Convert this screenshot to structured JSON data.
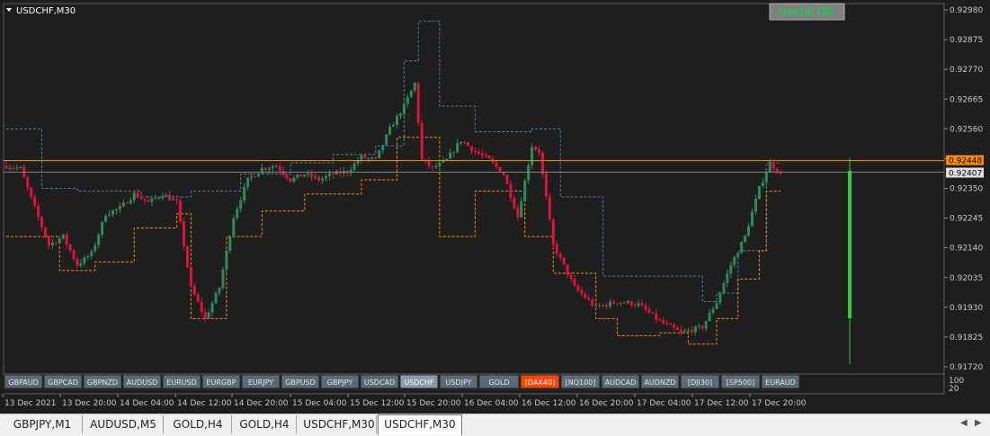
{
  "window": {
    "title": "USDCHF,M30"
  },
  "indicator_button": {
    "label": "fractal ON",
    "color": "#00e040"
  },
  "colors": {
    "background": "#1e1e1e",
    "bull_candle": "#2e8b57",
    "bear_candle": "#dc143c",
    "upper_fractal_line": "#4d7ea8",
    "lower_fractal_line": "#ff8c00",
    "bid_line": "#ff8c00",
    "ask_line": "#808080",
    "histogram": "#32cd32",
    "grid_text": "#c8c8c8"
  },
  "price_axis": {
    "ticks": [
      "0.92980",
      "0.92875",
      "0.92770",
      "0.92665",
      "0.92560",
      "0.92455",
      "0.92350",
      "0.92245",
      "0.92140",
      "0.92035",
      "0.91930",
      "0.91825",
      "0.91720"
    ],
    "current_bid_label": "0.92448",
    "current_ask_label": "0.92407",
    "sub_window_top": "100",
    "sub_window_bottom": "20"
  },
  "time_axis": {
    "labels": [
      "13 Dec 2021",
      "13 Dec 20:00",
      "14 Dec 04:00",
      "14 Dec 12:00",
      "14 Dec 20:00",
      "15 Dec 04:00",
      "15 Dec 12:00",
      "15 Dec 20:00",
      "16 Dec 04:00",
      "16 Dec 12:00",
      "16 Dec 20:00",
      "17 Dec 04:00",
      "17 Dec 12:00",
      "17 Dec 20:00"
    ]
  },
  "symbol_buttons": [
    {
      "label": "GBPAUD",
      "state": "normal"
    },
    {
      "label": "GBPCAD",
      "state": "normal"
    },
    {
      "label": "GBPNZD",
      "state": "normal"
    },
    {
      "label": "AUDUSD",
      "state": "normal"
    },
    {
      "label": "EURUSD",
      "state": "normal"
    },
    {
      "label": "EURGBP",
      "state": "normal"
    },
    {
      "label": "EURJPY",
      "state": "normal"
    },
    {
      "label": "GBPUSD",
      "state": "normal"
    },
    {
      "label": "GBPJPY",
      "state": "normal"
    },
    {
      "label": "USDCAD",
      "state": "normal"
    },
    {
      "label": "USDCHF",
      "state": "selected"
    },
    {
      "label": "USDJPY",
      "state": "normal"
    },
    {
      "label": "GOLD",
      "state": "normal"
    },
    {
      "label": "[DAX40]",
      "state": "highlight"
    },
    {
      "label": "[NQ100]",
      "state": "normal"
    },
    {
      "label": "AUDCAD",
      "state": "normal"
    },
    {
      "label": "AUDNZD",
      "state": "normal"
    },
    {
      "label": "[DJI30]",
      "state": "normal"
    },
    {
      "label": "[SP500]",
      "state": "normal"
    },
    {
      "label": "EURAUD",
      "state": "normal"
    }
  ],
  "tabs": [
    {
      "label": "GBPJPY,M1",
      "active": false
    },
    {
      "label": "AUDUSD,M5",
      "active": false
    },
    {
      "label": "GOLD,H4",
      "active": false
    },
    {
      "label": "GOLD,H4",
      "active": false
    },
    {
      "label": "USDCHF,M30",
      "active": false
    },
    {
      "label": "USDCHF,M30",
      "active": true
    }
  ],
  "chart_data": {
    "type": "candlestick",
    "symbol": "USDCHF",
    "timeframe": "M30",
    "ylim": [
      0.9172,
      0.9298
    ],
    "start_time": "13 Dec 2021",
    "anchors": [
      [
        0,
        0.9243
      ],
      [
        4,
        0.9242
      ],
      [
        8,
        0.9228
      ],
      [
        12,
        0.9215
      ],
      [
        16,
        0.9218
      ],
      [
        20,
        0.9208
      ],
      [
        24,
        0.9212
      ],
      [
        28,
        0.9226
      ],
      [
        32,
        0.9228
      ],
      [
        36,
        0.9233
      ],
      [
        40,
        0.923
      ],
      [
        44,
        0.9233
      ],
      [
        48,
        0.923
      ],
      [
        52,
        0.92
      ],
      [
        56,
        0.9189
      ],
      [
        60,
        0.92
      ],
      [
        64,
        0.9225
      ],
      [
        68,
        0.9238
      ],
      [
        72,
        0.9242
      ],
      [
        76,
        0.9243
      ],
      [
        80,
        0.9238
      ],
      [
        84,
        0.924
      ],
      [
        88,
        0.9238
      ],
      [
        92,
        0.924
      ],
      [
        96,
        0.9241
      ],
      [
        100,
        0.9246
      ],
      [
        104,
        0.9245
      ],
      [
        108,
        0.9256
      ],
      [
        112,
        0.9264
      ],
      [
        115,
        0.9272
      ],
      [
        117,
        0.9245
      ],
      [
        120,
        0.9242
      ],
      [
        124,
        0.9245
      ],
      [
        128,
        0.9252
      ],
      [
        132,
        0.9248
      ],
      [
        136,
        0.9245
      ],
      [
        140,
        0.924
      ],
      [
        144,
        0.9225
      ],
      [
        148,
        0.925
      ],
      [
        150,
        0.9248
      ],
      [
        154,
        0.9215
      ],
      [
        160,
        0.92
      ],
      [
        166,
        0.9193
      ],
      [
        172,
        0.9195
      ],
      [
        178,
        0.9194
      ],
      [
        184,
        0.9188
      ],
      [
        190,
        0.9184
      ],
      [
        196,
        0.9186
      ],
      [
        200,
        0.9195
      ],
      [
        204,
        0.9208
      ],
      [
        208,
        0.9218
      ],
      [
        212,
        0.9235
      ],
      [
        215,
        0.9244
      ],
      [
        218,
        0.924
      ]
    ],
    "upper_fractal_anchors": [
      [
        0,
        0.9256
      ],
      [
        10,
        0.9235
      ],
      [
        20,
        0.9234
      ],
      [
        38,
        0.9232
      ],
      [
        52,
        0.9234
      ],
      [
        66,
        0.924
      ],
      [
        80,
        0.9244
      ],
      [
        92,
        0.9247
      ],
      [
        104,
        0.925
      ],
      [
        112,
        0.928
      ],
      [
        116,
        0.9294
      ],
      [
        122,
        0.9264
      ],
      [
        132,
        0.9255
      ],
      [
        148,
        0.9256
      ],
      [
        156,
        0.9232
      ],
      [
        168,
        0.9204
      ],
      [
        186,
        0.9204
      ],
      [
        196,
        0.9195
      ],
      [
        200,
        0.9198
      ],
      [
        206,
        0.9213
      ],
      [
        214,
        0.9244
      ],
      [
        218,
        0.9244
      ]
    ],
    "lower_fractal_anchors": [
      [
        0,
        0.9218
      ],
      [
        15,
        0.9206
      ],
      [
        25,
        0.9209
      ],
      [
        36,
        0.9221
      ],
      [
        48,
        0.9226
      ],
      [
        52,
        0.9189
      ],
      [
        62,
        0.9218
      ],
      [
        72,
        0.9227
      ],
      [
        84,
        0.9233
      ],
      [
        100,
        0.9238
      ],
      [
        110,
        0.9253
      ],
      [
        122,
        0.9218
      ],
      [
        132,
        0.9234
      ],
      [
        146,
        0.9218
      ],
      [
        154,
        0.9205
      ],
      [
        166,
        0.9189
      ],
      [
        172,
        0.9183
      ],
      [
        184,
        0.9184
      ],
      [
        192,
        0.918
      ],
      [
        200,
        0.9189
      ],
      [
        206,
        0.9203
      ],
      [
        212,
        0.9213
      ],
      [
        214,
        0.9234
      ],
      [
        218,
        0.9234
      ]
    ],
    "bid": 0.92448,
    "ask": 0.92407,
    "histogram_bar": {
      "value": 100,
      "range": [
        20,
        100
      ]
    }
  }
}
